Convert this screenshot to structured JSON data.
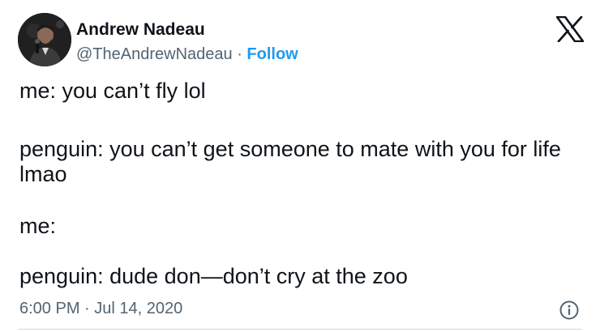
{
  "author": {
    "name": "Andrew Nadeau",
    "handle": "@TheAndrewNadeau",
    "separator": " · ",
    "follow_label": "Follow",
    "avatar_icon": "profile-photo-icon"
  },
  "brand": {
    "logo_icon": "x-logo-icon"
  },
  "tweet": {
    "lines": [
      "me: you can’t fly lol",
      "penguin: you can’t get someone to mate with you for life lmao",
      "me:",
      "penguin: dude don—don’t cry at the zoo"
    ]
  },
  "meta": {
    "time": "6:00 PM",
    "separator": " · ",
    "date": "Jul 14, 2020",
    "info_icon": "info-icon"
  },
  "colors": {
    "accent": "#1d9bf0",
    "text": "#0f1419",
    "secondary": "#536471",
    "border": "#cfd9de"
  }
}
